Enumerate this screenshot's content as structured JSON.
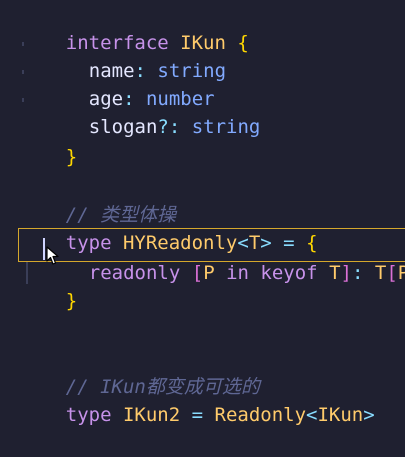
{
  "code_lines": {
    "l1": [
      "interface",
      " ",
      "IKun",
      " ",
      "{"
    ],
    "l2": [
      "name",
      ": ",
      "string"
    ],
    "l3": [
      "age",
      ": ",
      "number"
    ],
    "l4": [
      "slogan",
      "?: ",
      "string"
    ],
    "l5": [
      "}"
    ],
    "l6": [
      "// 类型体操"
    ],
    "l7": [
      "type",
      " ",
      "HYReadonly",
      "<",
      "T",
      ">",
      " = ",
      "{"
    ],
    "l8": [
      "readonly",
      " ",
      "[",
      "P",
      " in ",
      "keyof",
      " ",
      "T",
      "]",
      ": ",
      "T",
      "[",
      "P",
      "]"
    ],
    "l9": [
      "}"
    ],
    "l10": [
      "// IKun都变成可选的"
    ],
    "l11": [
      "type",
      " ",
      "IKun2",
      " = ",
      "Readonly",
      "<",
      "IKun",
      ">"
    ]
  },
  "colors": {
    "background": "#1f2030",
    "keyword": "#c792ea",
    "type": "#ffcb6b",
    "comment": "#5f6794",
    "highlight": "#d4a72c"
  },
  "icons": {
    "mouse": "mouse-pointer-icon"
  }
}
